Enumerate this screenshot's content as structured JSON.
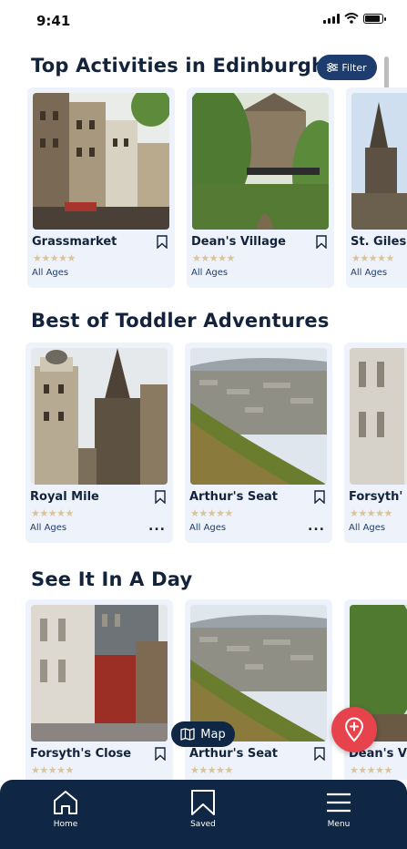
{
  "status_bar": {
    "time": "9:41",
    "battery_level": 0.9
  },
  "sections": [
    {
      "title": "Top Activities in Edinburgh",
      "cards": [
        {
          "name": "Grassmarket",
          "age": "All Ages",
          "rating": 5,
          "image": "old-town-street"
        },
        {
          "name": "Dean's Village",
          "age": "All Ages",
          "rating": 5,
          "image": "village-bridge"
        },
        {
          "name": "St. Giles",
          "age": "All Ages",
          "rating": 5,
          "image": "cathedral-spire"
        }
      ]
    },
    {
      "title": "Best of Toddler Adventures",
      "cards": [
        {
          "name": "Royal Mile",
          "age": "All Ages",
          "rating": 5,
          "image": "royal-mile",
          "more": "..."
        },
        {
          "name": "Arthur's Seat",
          "age": "All Ages",
          "rating": 5,
          "image": "hill-view",
          "more": "..."
        },
        {
          "name": "Forsyth'",
          "age": "All Ages",
          "rating": 5,
          "image": "stone-close"
        }
      ]
    },
    {
      "title": "See It In A Day",
      "cards": [
        {
          "name": "Forsyth's Close",
          "rating": 5,
          "image": "close-alley"
        },
        {
          "name": "Arthur's Seat",
          "rating": 5,
          "image": "hill-view"
        },
        {
          "name": "Dean's V",
          "rating": 5,
          "image": "green-lane"
        }
      ]
    }
  ],
  "filter_button": {
    "label": "Filter"
  },
  "map_button": {
    "label": "Map"
  },
  "nav": [
    {
      "label": "Home",
      "icon": "home-icon"
    },
    {
      "label": "Saved",
      "icon": "bookmark-icon"
    },
    {
      "label": "Menu",
      "icon": "menu-icon"
    }
  ],
  "colors": {
    "navy": "#0f2744",
    "accent": "#1c3d6e",
    "fab": "#e7434d",
    "card_bg": "#eef2fa",
    "stars": "#d8c49c"
  }
}
